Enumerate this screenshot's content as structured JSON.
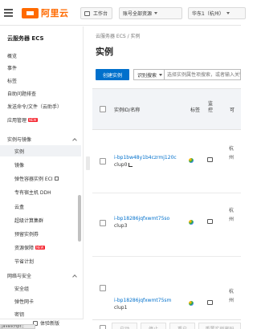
{
  "topbar": {
    "logo_text": "阿里云",
    "workbench_label": "工作台",
    "account_label": "账号全部资源",
    "region_label": "华东1（杭州）"
  },
  "sidebar": {
    "title": "云服务器 ECS",
    "top_items": [
      "概览",
      "事件",
      "标签",
      "自助问题排查",
      "发送命令/文件（云助手）",
      "应用管理"
    ],
    "new_badge": "NEW",
    "section_instances": "实例与镜像",
    "instance_items": [
      "实例",
      "镜像",
      "弹性容器实例 ECI",
      "专有宿主机 DDH",
      "云盒",
      "超级计算集群",
      "预留实例券",
      "资源保障",
      "节省计划"
    ],
    "section_network": "网络与安全",
    "network_items": [
      "安全组",
      "弹性网卡",
      "密钥"
    ],
    "feedback_label": "体验新版",
    "status_url": "javascript:;"
  },
  "main": {
    "breadcrumb": "云服务器 ECS  /  实例",
    "title": "实例",
    "create_button": "创建实例",
    "search_type": "识别搜索",
    "search_placeholder": "选择实例属性项搜索，或者输入关键字识别搜索",
    "columns": {
      "id_name": "实例ID/名称",
      "tag": "标签",
      "monitor": "监控",
      "extra": "可"
    },
    "rows": [
      {
        "id": "i-bp1bw48y1b4czrmj120c",
        "name": "clup0",
        "extra": "杭州"
      },
      {
        "id": "i-bp18286jqfxwmt75so",
        "name": "clup3",
        "extra": "杭州"
      },
      {
        "id": "i-bp18286jqfxwmt75sm",
        "name": "clup1",
        "extra": "杭州"
      }
    ],
    "bottom_buttons": [
      "启动",
      "停止",
      "重启",
      "重置实例密码"
    ]
  }
}
